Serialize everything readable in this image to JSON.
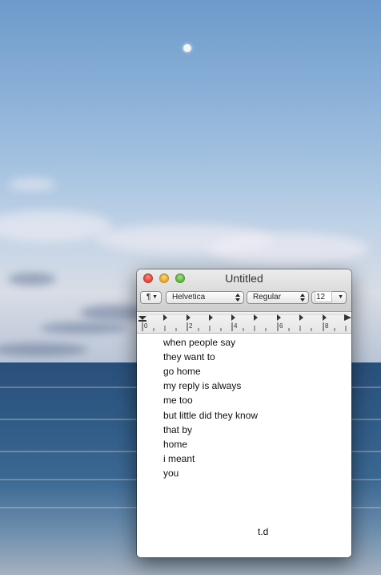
{
  "window": {
    "title": "Untitled"
  },
  "toolbar": {
    "paragraph_label": "¶",
    "font_family": "Helvetica",
    "typeface": "Regular",
    "font_size": "12"
  },
  "ruler": {
    "labels": [
      "0",
      "2",
      "4",
      "6",
      "8"
    ]
  },
  "document": {
    "lines": [
      "when people say",
      "they want to",
      "go home",
      "my reply is always",
      "me too",
      "but little did they know",
      "that by",
      "home",
      "i meant",
      "you"
    ],
    "signature": "t.d"
  },
  "icons": {
    "close": "close-dot-icon",
    "minimize": "minimize-dot-icon",
    "zoom": "zoom-dot-icon",
    "dropdown": "chevron-down-icon",
    "stepper": "up-down-stepper-icon",
    "tab_stop": "tab-stop-icon"
  }
}
